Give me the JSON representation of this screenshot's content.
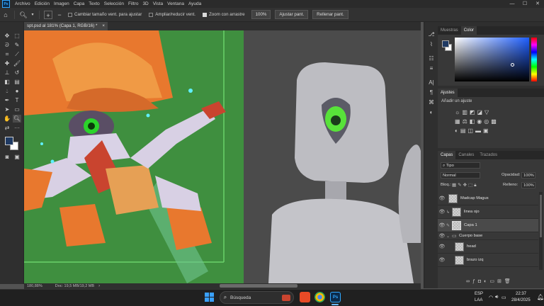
{
  "menu": {
    "app_icon": "Ps",
    "items": [
      "Archivo",
      "Edición",
      "Imagen",
      "Capa",
      "Texto",
      "Selección",
      "Filtro",
      "3D",
      "Vista",
      "Ventana",
      "Ayuda"
    ]
  },
  "window_controls": {
    "minimize": "—",
    "maximize": "☐",
    "close": "✕"
  },
  "options_bar": {
    "resize_windows": "Cambiar tamaño vent. para ajustar",
    "zoom_all": "Ampliar/reducir vent.",
    "scrubby_zoom": "Zoom con arrastre",
    "zoom_level": "100%",
    "fit_screen": "Ajustar pant.",
    "fill_screen": "Rellenar pant."
  },
  "document_tab": {
    "title": "spt.psd al 181% (Capa 1, RGB/16) *",
    "close": "×"
  },
  "status_bar": {
    "zoom": "180,88%",
    "doc_info": "Doc: 19,5 MB/19,2 MB"
  },
  "panels": {
    "color_tabs": [
      "Muestras",
      "Color"
    ],
    "adjustments_tab": "Ajustes",
    "add_adjustment": "Añadir un ajuste",
    "layers_tabs": [
      "Capas",
      "Canales",
      "Trazados"
    ],
    "filter_kind": "Tipo",
    "blend_mode": "Normal",
    "opacity_label": "Opacidad:",
    "opacity_value": "100%",
    "lock_label": "Bloq.:",
    "fill_label": "Relleno:",
    "fill_value": "100%",
    "layers": [
      {
        "name": "Madcap Magus"
      },
      {
        "name": "linea ojo"
      },
      {
        "name": "Capa 1"
      },
      {
        "name": "Cuerpo base"
      },
      {
        "name": "head"
      },
      {
        "name": "brazo izq"
      }
    ]
  },
  "taskbar": {
    "search_placeholder": "Búsqueda",
    "lang_top": "ESP",
    "lang_bottom": "LAA",
    "time": "22:37",
    "date": "28/4/2025"
  },
  "colors": {
    "foreground": "#1f3a63",
    "background": "#ffffff",
    "canvas_green": "#3f8f3f",
    "accent": "#31a8ff"
  }
}
